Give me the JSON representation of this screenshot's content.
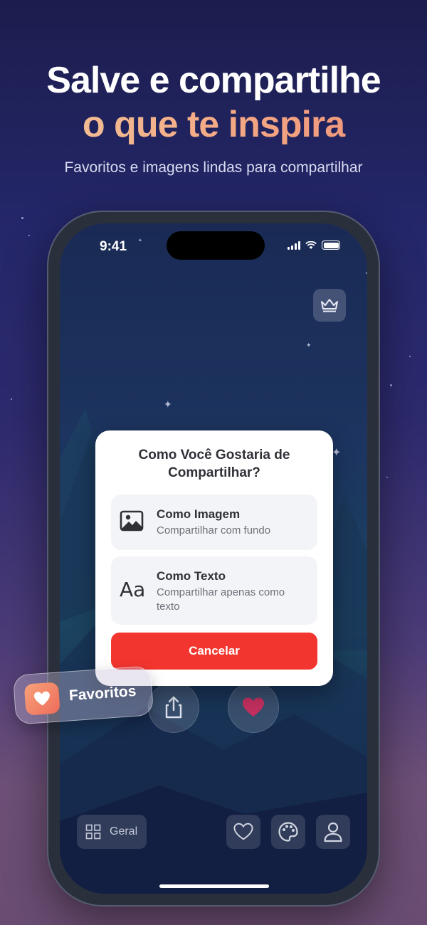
{
  "header": {
    "title_line1": "Salve e compartilhe",
    "title_line2": "o que te inspira",
    "subtitle": "Favoritos e imagens lindas para compartilhar"
  },
  "status_bar": {
    "time": "9:41"
  },
  "modal": {
    "title": "Como Você Gostaria de Compartilhar?",
    "options": [
      {
        "title": "Como Imagem",
        "subtitle": "Compartilhar com fundo",
        "icon": "image-icon"
      },
      {
        "title": "Como Texto",
        "subtitle": "Compartilhar apenas como texto",
        "icon": "text-aa-icon",
        "icon_text": "Aa"
      }
    ],
    "cancel_label": "Cancelar"
  },
  "floating_badge": {
    "label": "Favoritos",
    "icon": "heart-icon"
  },
  "bottom_nav": {
    "category_label": "Geral",
    "items": [
      "heart-icon",
      "palette-icon",
      "profile-icon"
    ]
  },
  "colors": {
    "accent_red": "#f3352f",
    "heart_pink": "#c2305f",
    "badge_orange": "#f09070"
  }
}
